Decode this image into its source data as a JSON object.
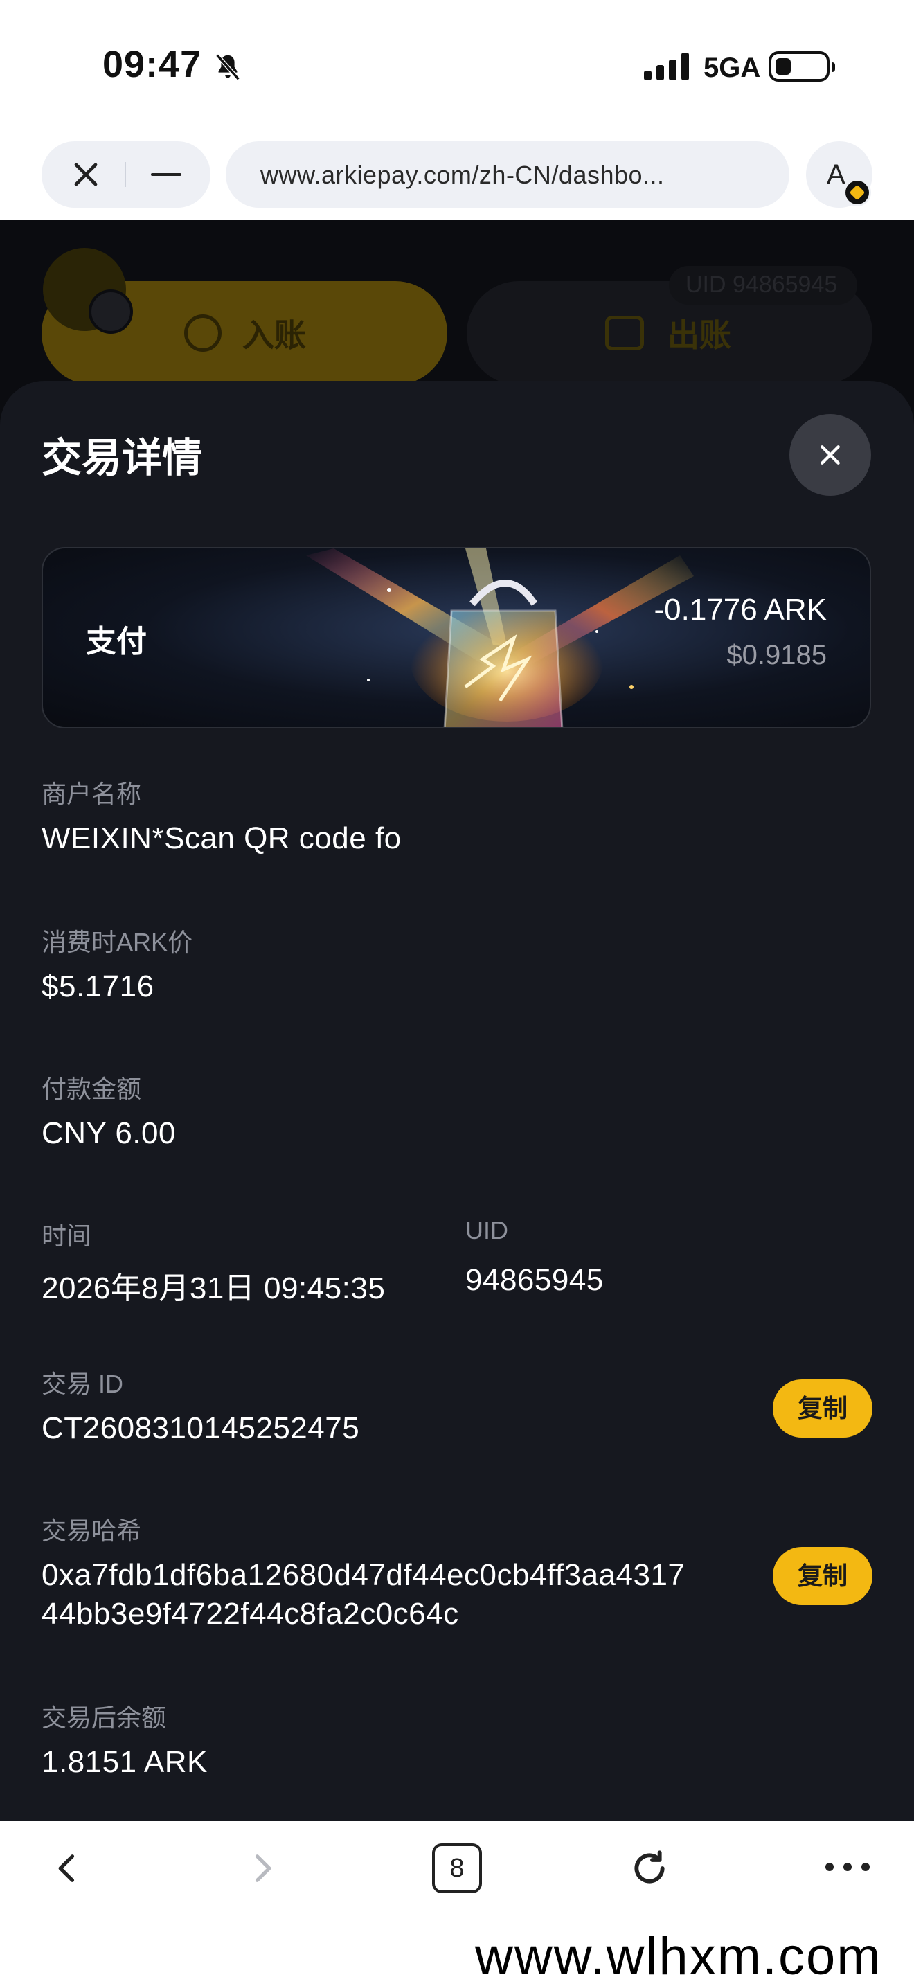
{
  "status_bar": {
    "time": "09:47",
    "network": "5GA"
  },
  "browser": {
    "url": "www.arkiepay.com/zh-CN/dashbo...",
    "account_initial": "A",
    "tab_count": "8"
  },
  "background_page": {
    "deposit_label": "入账",
    "withdraw_label": "出账",
    "uid_label": "UID 94865945"
  },
  "sheet": {
    "title": "交易详情",
    "hero": {
      "type_label": "支付",
      "amount": "-0.1776 ARK",
      "usd_value": "$0.9185"
    },
    "fields": {
      "merchant_label": "商户名称",
      "merchant_value": "WEIXIN*Scan QR code fo",
      "ark_price_label": "消费时ARK价",
      "ark_price_value": "$5.1716",
      "payment_label": "付款金额",
      "payment_value": "CNY 6.00",
      "time_label": "时间",
      "time_value": "2026年8月31日 09:45:35",
      "uid_label": "UID",
      "uid_value": "94865945",
      "txid_label": "交易 ID",
      "txid_value": "CT2608310145252475",
      "hash_label": "交易哈希",
      "hash_line1": "0xa7fdb1df6ba12680d47df44ec0cb4ff3aa4317",
      "hash_line2": "44bb3e9f4722f44c8fa2c0c64c",
      "balance_label": "交易后余额",
      "balance_value": "1.8151 ARK"
    },
    "copy_label": "复制"
  },
  "watermark": "www.wlhxm.com",
  "colors": {
    "accent": "#f3b812",
    "sheet_bg": "#16181f",
    "label": "#8e919b"
  }
}
